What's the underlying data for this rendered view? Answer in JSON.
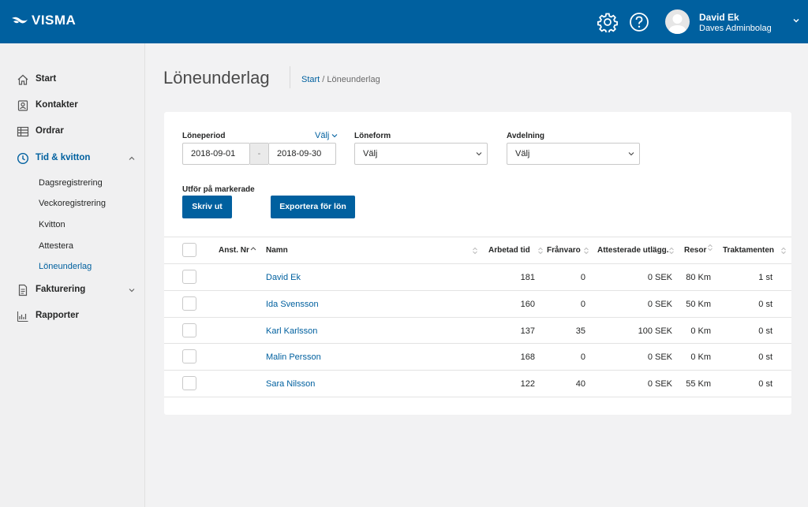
{
  "topbar": {
    "brand": "VISMA",
    "user_name": "David Ek",
    "user_company": "Daves Adminbolag",
    "icons": [
      "gear-icon",
      "help-icon",
      "avatar",
      "chevron-down-icon"
    ]
  },
  "sidebar": {
    "items": [
      {
        "label": "Start",
        "icon": "home-icon"
      },
      {
        "label": "Kontakter",
        "icon": "contact-icon"
      },
      {
        "label": "Ordrar",
        "icon": "table-icon"
      },
      {
        "label": "Tid & kvitton",
        "icon": "clock-icon"
      },
      {
        "label": "Fakturering",
        "icon": "invoice-icon"
      },
      {
        "label": "Rapporter",
        "icon": "report-icon"
      }
    ],
    "sub_items": [
      {
        "label": "Dagsregistrering"
      },
      {
        "label": "Veckoregistrering"
      },
      {
        "label": "Kvitton"
      },
      {
        "label": "Attestera"
      },
      {
        "label": "Löneunderlag"
      }
    ]
  },
  "header": {
    "title": "Löneunderlag",
    "breadcrumb_home": "Start",
    "breadcrumb_current": " / Löneunderlag"
  },
  "filters": {
    "period_label": "Löneperiod",
    "period_valj": "Välj",
    "date_from": "2018-09-01",
    "date_sep": "-",
    "date_to": "2018-09-30",
    "loneform_label": "Löneform",
    "loneform_value": "Välj",
    "avdelning_label": "Avdelning",
    "avdelning_value": "Välj",
    "selected_label": "Utför på markerade",
    "print_button": "Skriv ut",
    "export_button": "Exportera för lön"
  },
  "table": {
    "headers": {
      "anst_nr": "Anst. Nr",
      "namn": "Namn",
      "arbetad_tid": "Arbetad tid",
      "franvaro": "Frånvaro",
      "attesterade": "Attesterade utlägg.",
      "resor": "Resor",
      "traktamenten": "Traktamenten"
    },
    "rows": [
      {
        "namn": "David Ek",
        "arbetad_tid": "181",
        "franvaro": "0",
        "attesterade": "0 SEK",
        "resor": "80 Km",
        "traktamenten": "1 st"
      },
      {
        "namn": "Ida Svensson",
        "arbetad_tid": "160",
        "franvaro": "0",
        "attesterade": "0 SEK",
        "resor": "50 Km",
        "traktamenten": "0 st"
      },
      {
        "namn": "Karl Karlsson",
        "arbetad_tid": "137",
        "franvaro": "35",
        "attesterade": "100 SEK",
        "resor": "0 Km",
        "traktamenten": "0 st"
      },
      {
        "namn": "Malin Persson",
        "arbetad_tid": "168",
        "franvaro": "0",
        "attesterade": "0 SEK",
        "resor": "0 Km",
        "traktamenten": "0 st"
      },
      {
        "namn": "Sara Nilsson",
        "arbetad_tid": "122",
        "franvaro": "40",
        "attesterade": "0 SEK",
        "resor": "55 Km",
        "traktamenten": "0 st"
      }
    ]
  },
  "colors": {
    "brand": "#00609f",
    "background": "#f2f2f3",
    "card": "#ffffff"
  }
}
